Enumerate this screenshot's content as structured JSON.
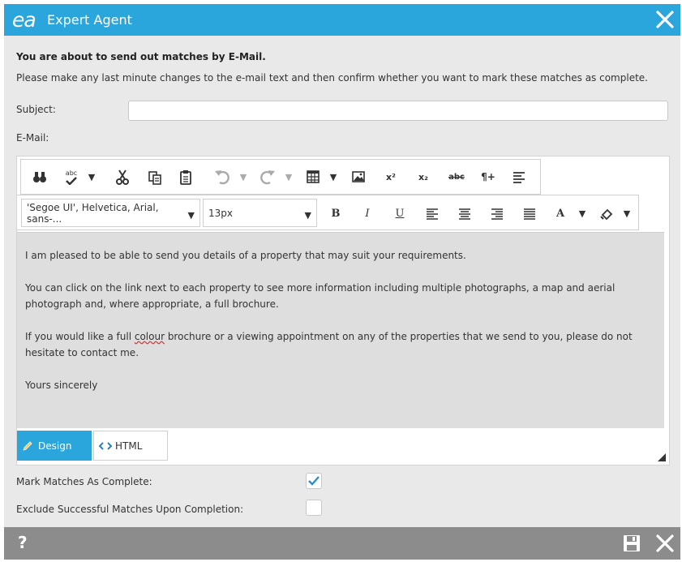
{
  "window": {
    "logo_text": "ea",
    "title": "Expert Agent"
  },
  "main": {
    "heading": "You are about to send out matches by E-Mail.",
    "instruction": "Please make any last minute changes to the e-mail text and then confirm whether you want to mark these matches as complete.",
    "subject_label": "Subject:",
    "subject_value": "",
    "email_label": "E-Mail:"
  },
  "editor": {
    "toolbar_icons": [
      "find-icon",
      "spellcheck-icon",
      "cut-icon",
      "copy-icon",
      "paste-icon",
      "undo-icon",
      "redo-icon",
      "table-icon",
      "image-icon",
      "superscript-icon",
      "subscript-icon",
      "strikethrough-icon",
      "paragraph-icon",
      "align-icon"
    ],
    "font_family": "'Segoe UI', Helvetica, Arial, sans-...",
    "font_size": "13px",
    "bold_label": "B",
    "italic_label": "I",
    "underline_label": "U",
    "font_color_label": "A",
    "superscript_label": "x²",
    "subscript_label": "x₂",
    "strike_label": "abc",
    "spell_label": "abc",
    "paragraph_label": "¶+",
    "body": {
      "p1": "I am pleased to be able to send you details of a property that may suit your requirements.",
      "p2": "You can click on the link next to each property to see more information including multiple photographs, a map and aerial photograph and, where appropriate, a full brochure.",
      "p3_before": "If you would like a full ",
      "p3_spell": "colour",
      "p3_after": " brochure or a viewing appointment on any of the properties that we send to you, please do not hesitate to contact me.",
      "closing": "Yours sincerely"
    },
    "mode_design": "Design",
    "mode_html": "HTML"
  },
  "options": {
    "mark_complete_label": "Mark Matches As Complete:",
    "mark_complete_checked": true,
    "exclude_label": "Exclude Successful Matches Upon Completion:",
    "exclude_checked": false
  },
  "footer": {
    "help_label": "?"
  },
  "colors": {
    "accent": "#2aa6dc",
    "footer": "#8c8c8c",
    "panel": "#e9e9e9"
  }
}
